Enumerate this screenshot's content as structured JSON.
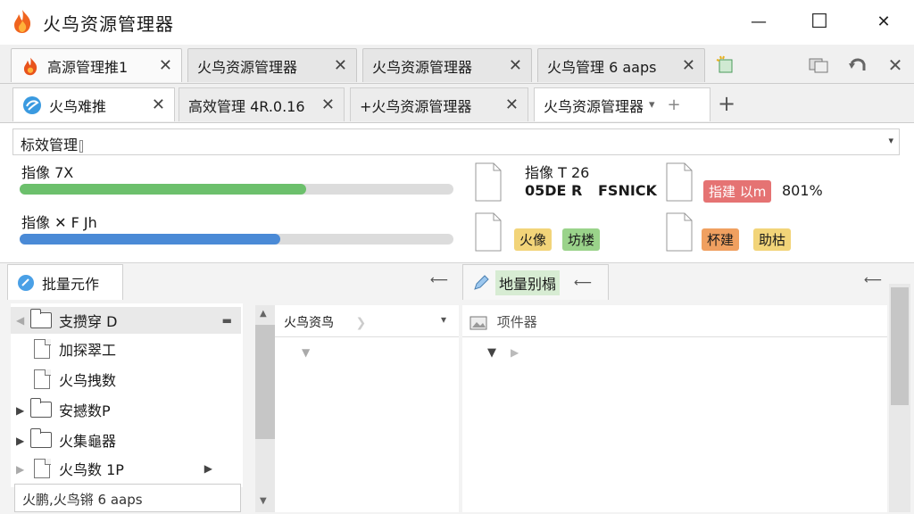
{
  "window": {
    "title": "火鸟资源管理器",
    "minimize_glyph": "—",
    "maximize_glyph": "☐",
    "close_glyph": "✕"
  },
  "tabs_row1": [
    {
      "label": "高源管理推1",
      "icon": "flame-icon"
    },
    {
      "label": "火鸟资源管理器"
    },
    {
      "label": "火鸟资源管理器"
    },
    {
      "label": "火鸟管理 6 aaps"
    }
  ],
  "tabs_row2": [
    {
      "label": "火鸟难推",
      "icon": "globe-icon"
    },
    {
      "label": "高效管理 4R.0.16"
    },
    {
      "label": "+火鸟资源管理器"
    },
    {
      "label": "火鸟资源管理器"
    }
  ],
  "close_glyph": "✕",
  "new_tab_glyph": "+",
  "dropdown_glyph": "▾",
  "address": {
    "value": "标效管理"
  },
  "progress": [
    {
      "label": "指像 7X",
      "fraction": 0.66,
      "color": "#6cc06c"
    },
    {
      "label": "指像 ✕ F Jh",
      "fraction": 0.6,
      "color": "#4a8ad6"
    }
  ],
  "cards": {
    "card1": {
      "title": "指像 T 26",
      "line1": "05DE R",
      "line2": "FSNICK"
    },
    "card2": {
      "badge": "指建 以m",
      "badge_color": "#e57373",
      "value": "801%"
    },
    "card3": {
      "badge_a": "火像",
      "badge_a_color": "#f2d479",
      "badge_b": "坊楼",
      "badge_b_color": "#9ad38a"
    },
    "card4": {
      "badge_a": "杯建",
      "badge_a_color": "#f0a060",
      "badge_b": "助枯",
      "badge_b_color": "#f2d479"
    }
  },
  "left_pane": {
    "tab_label": "批量元作",
    "pin_glyph": "⟵",
    "tree": [
      {
        "label": "支攒穿 D",
        "type": "folder",
        "expanded": true
      },
      {
        "label": "加探翠工",
        "type": "doc"
      },
      {
        "label": "火鸟拽数",
        "type": "doc"
      },
      {
        "label": "安撼数P",
        "type": "folder"
      },
      {
        "label": "火集龜器",
        "type": "folder"
      },
      {
        "label": "火鸟数 1P",
        "type": "doc"
      }
    ],
    "status": "火鹏,火鸟锵 6 aaps"
  },
  "mid_pane": {
    "header": "火鸟资鸟"
  },
  "right_pane": {
    "tab_label": "地量别榻",
    "pin_glyph": "⟵",
    "header": "项件器"
  }
}
